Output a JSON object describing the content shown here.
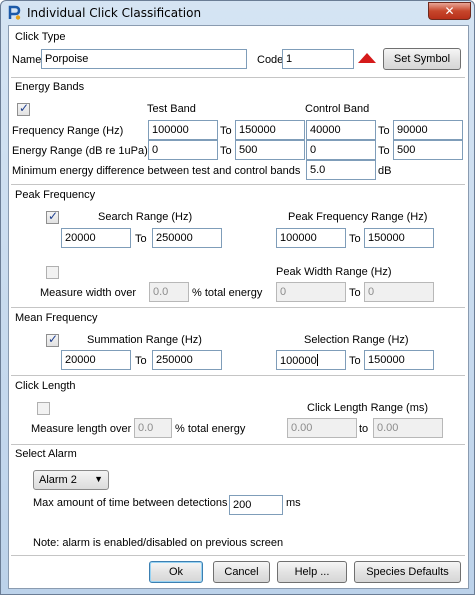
{
  "window": {
    "title": "Individual Click Classification",
    "close_glyph": "✕"
  },
  "click_type": {
    "section": "Click Type",
    "name_label": "Name",
    "name_value": "Porpoise",
    "code_label": "Code",
    "code_value": "1",
    "symbol_color": "#d51a1a",
    "set_symbol": "Set Symbol"
  },
  "energy_bands": {
    "section": "Energy Bands",
    "enabled": true,
    "test_band": "Test Band",
    "control_band": "Control Band",
    "freq_label": "Frequency Range (Hz)",
    "freq_test_from": "100000",
    "freq_test_to": "150000",
    "freq_ctrl_from": "40000",
    "freq_ctrl_to": "90000",
    "energy_label": "Energy Range (dB re 1uPa)",
    "energy_test_from": "0",
    "energy_test_to": "500",
    "energy_ctrl_from": "0",
    "energy_ctrl_to": "500",
    "min_diff_label": "Minimum energy difference between test and control bands",
    "min_diff_value": "5.0",
    "min_diff_unit": "dB",
    "to": "To"
  },
  "peak_frequency": {
    "section": "Peak Frequency",
    "search_enabled": true,
    "search_label": "Search Range (Hz)",
    "search_from": "20000",
    "search_to": "250000",
    "peak_range_label": "Peak Frequency Range (Hz)",
    "peak_from": "100000",
    "peak_to": "150000",
    "width_enabled": false,
    "width_label": "Peak Width Range (Hz)",
    "measure_label": "Measure width over",
    "measure_value": "0.0",
    "pct_label": "% total energy",
    "width_from": "0",
    "width_to": "0",
    "to": "To"
  },
  "mean_frequency": {
    "section": "Mean Frequency",
    "enabled": true,
    "summation_label": "Summation Range (Hz)",
    "sum_from": "20000",
    "sum_to": "250000",
    "selection_label": "Selection Range (Hz)",
    "sel_from": "100000",
    "sel_to": "150000",
    "to": "To"
  },
  "click_length": {
    "section": "Click Length",
    "enabled": false,
    "range_label": "Click Length Range (ms)",
    "measure_label": "Measure length over",
    "measure_value": "0.0",
    "pct_label": "% total energy",
    "len_from": "0.00",
    "len_to": "0.00",
    "to": "to"
  },
  "select_alarm": {
    "section": "Select Alarm",
    "alarm_value": "Alarm 2",
    "max_time_label": "Max amount of time between detections",
    "max_time_value": "200",
    "max_time_unit": "ms",
    "note": "Note: alarm is enabled/disabled on previous screen"
  },
  "buttons": {
    "ok": "Ok",
    "cancel": "Cancel",
    "help": "Help ...",
    "defaults": "Species Defaults"
  }
}
